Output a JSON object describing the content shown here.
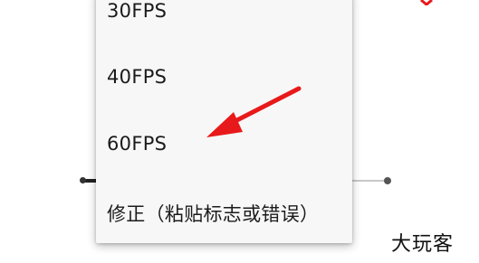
{
  "menu": {
    "items": [
      {
        "label": "30FPS"
      },
      {
        "label": "40FPS"
      },
      {
        "label": "60FPS"
      },
      {
        "label": "修正（粘贴标志或错误）"
      }
    ]
  },
  "annotation": {
    "arrow_color": "#e8191a",
    "points_to": "60FPS"
  },
  "watermark": {
    "text": "大玩客"
  },
  "slider": {
    "track_color": "#c8c8c8"
  }
}
